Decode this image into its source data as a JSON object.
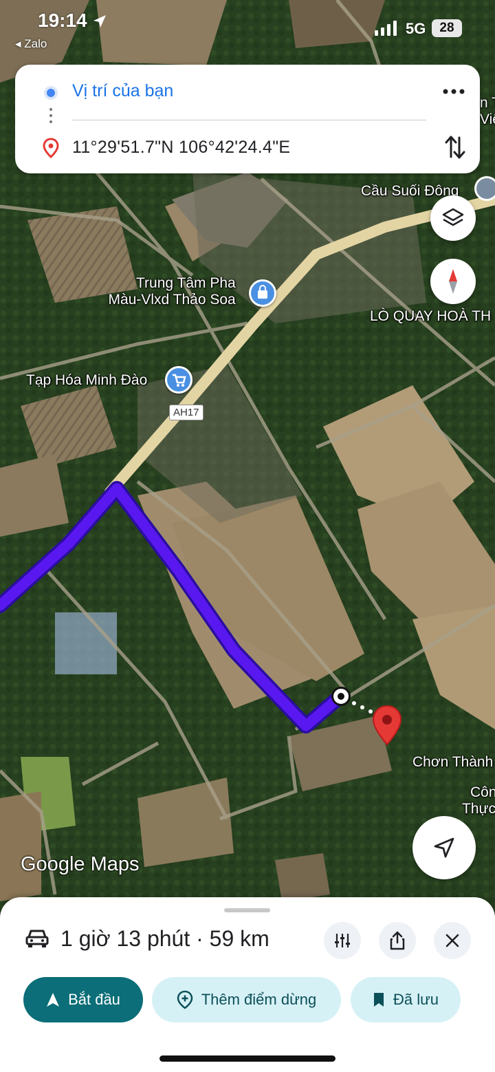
{
  "status_bar": {
    "time": "19:14",
    "back_app": "◂ Zalo",
    "network": "5G",
    "battery": "28"
  },
  "directions": {
    "origin": "Vị trí của bạn",
    "destination": "11°29'51.7\"N 106°42'24.4\"E"
  },
  "map": {
    "labels": {
      "bridge": "Cầu Suối Đông",
      "shop1_line1": "Trung Tâm Pha",
      "shop1_line2": "Màu-Vlxd Thảo Soa",
      "kiln": "LÒ QUAY HOÀ TH",
      "grocery": "Tạp Hóa Minh Đào",
      "road": "AH17",
      "chon_thanh": "Chơn Thành",
      "cong_line1": "Côn",
      "cong_line2": "Thực",
      "edge1": "n T",
      "edge2": "Việ"
    },
    "route_color": "#5a18f0",
    "pin_color": "#e53935"
  },
  "branding": {
    "logo": "Google Maps"
  },
  "sheet": {
    "summary": "1 giờ 13 phút · 59 km",
    "start_label": "Bắt đầu",
    "add_stop_label": "Thêm điểm dừng",
    "saved_label": "Đã lưu"
  },
  "colors": {
    "accent": "#0b6e78",
    "pill_light": "#d6f1f5",
    "link_blue": "#1a73e8"
  }
}
